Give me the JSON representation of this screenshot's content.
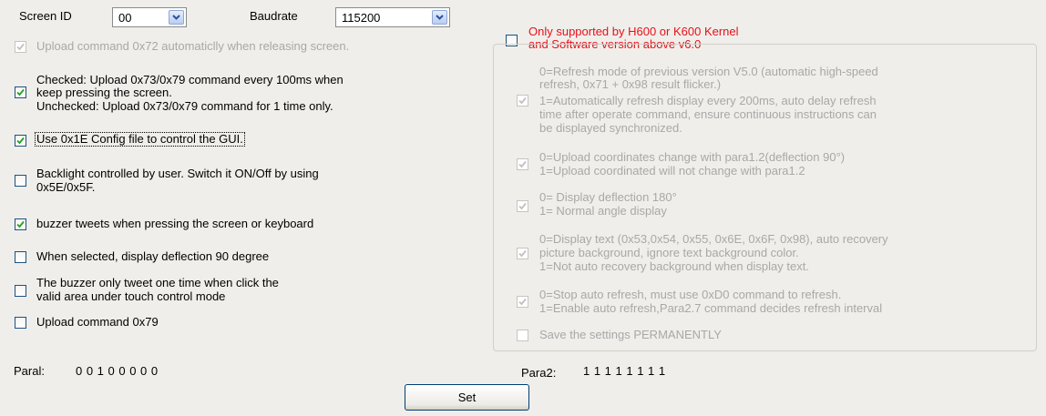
{
  "header": {
    "screen_id_label": "Screen ID",
    "screen_id_value": "00",
    "baudrate_label": "Baudrate",
    "baudrate_value": "115200"
  },
  "left_options": [
    {
      "text": "Upload command 0x72 automaticlly when  releasing screen.",
      "checked": true,
      "disabled": true
    },
    {
      "lines": [
        "Checked: Upload 0x73/0x79 command every 100ms when",
        "keep pressing the screen.",
        "Unchecked: Upload 0x73/0x79 command for 1 time only."
      ],
      "checked": true,
      "disabled": false
    },
    {
      "text": "Use 0x1E Config file to control the GUI.",
      "checked": true,
      "disabled": false
    },
    {
      "lines": [
        "Backlight controlled by user. Switch it ON/Off by using",
        "0x5E/0x5F."
      ],
      "checked": false,
      "disabled": false
    },
    {
      "text": "buzzer tweets when pressing the screen or keyboard",
      "checked": true,
      "disabled": false
    },
    {
      "text": "When selected, display deflection 90 degree",
      "checked": false,
      "disabled": false
    },
    {
      "lines": [
        "The buzzer only tweet one time when click the",
        "valid area under touch control mode"
      ],
      "checked": false,
      "disabled": false
    },
    {
      "text": "Upload command 0x79",
      "checked": false,
      "disabled": false
    }
  ],
  "right_panel": {
    "header_lines": [
      "Only supported by H600 or K600 Kernel",
      "and Software version above v6.0"
    ],
    "header_checked": false,
    "options": [
      {
        "lines": [
          "0=Refresh mode of previous version V5.0 (automatic high-speed",
          "   refresh, 0x71 + 0x98 result flicker.)",
          "1=Automatically refresh display every 200ms, auto delay refresh",
          "   time after operate command, ensure continuous instructions can",
          "   be displayed synchronized."
        ],
        "checked": true
      },
      {
        "lines": [
          "0=Upload coordinates change with para1.2(deflection 90°)",
          "1=Upload coordinated will not change with para1.2"
        ],
        "checked": true
      },
      {
        "lines": [
          "0= Display deflection 180°",
          "1= Normal angle display"
        ],
        "checked": true
      },
      {
        "lines": [
          "0=Display text (0x53,0x54, 0x55, 0x6E, 0x6F, 0x98), auto recovery",
          "   picture background, ignore text background color.",
          "1=Not auto recovery background when display text."
        ],
        "checked": true
      },
      {
        "lines": [
          "0=Stop auto refresh, must use 0xD0 command to refresh.",
          "1=Enable auto refresh,Para2.7 command decides refresh interval"
        ],
        "checked": true
      },
      {
        "text": "Save the settings PERMANENTLY",
        "checked": false
      }
    ]
  },
  "footer": {
    "para1_label": "Paral:",
    "para1_value": "0 0 1 0 0 0 0 0",
    "para2_label": "Para2:",
    "para2_value": "1 1 1 1 1 1 1 1",
    "set_label": "Set"
  },
  "colors": {
    "background": "#f0eeea",
    "disabled_text": "#a8a8a8",
    "warning_text": "#e8101a",
    "checkbox_border": "#1c5180",
    "checkmark": "#21a121"
  }
}
